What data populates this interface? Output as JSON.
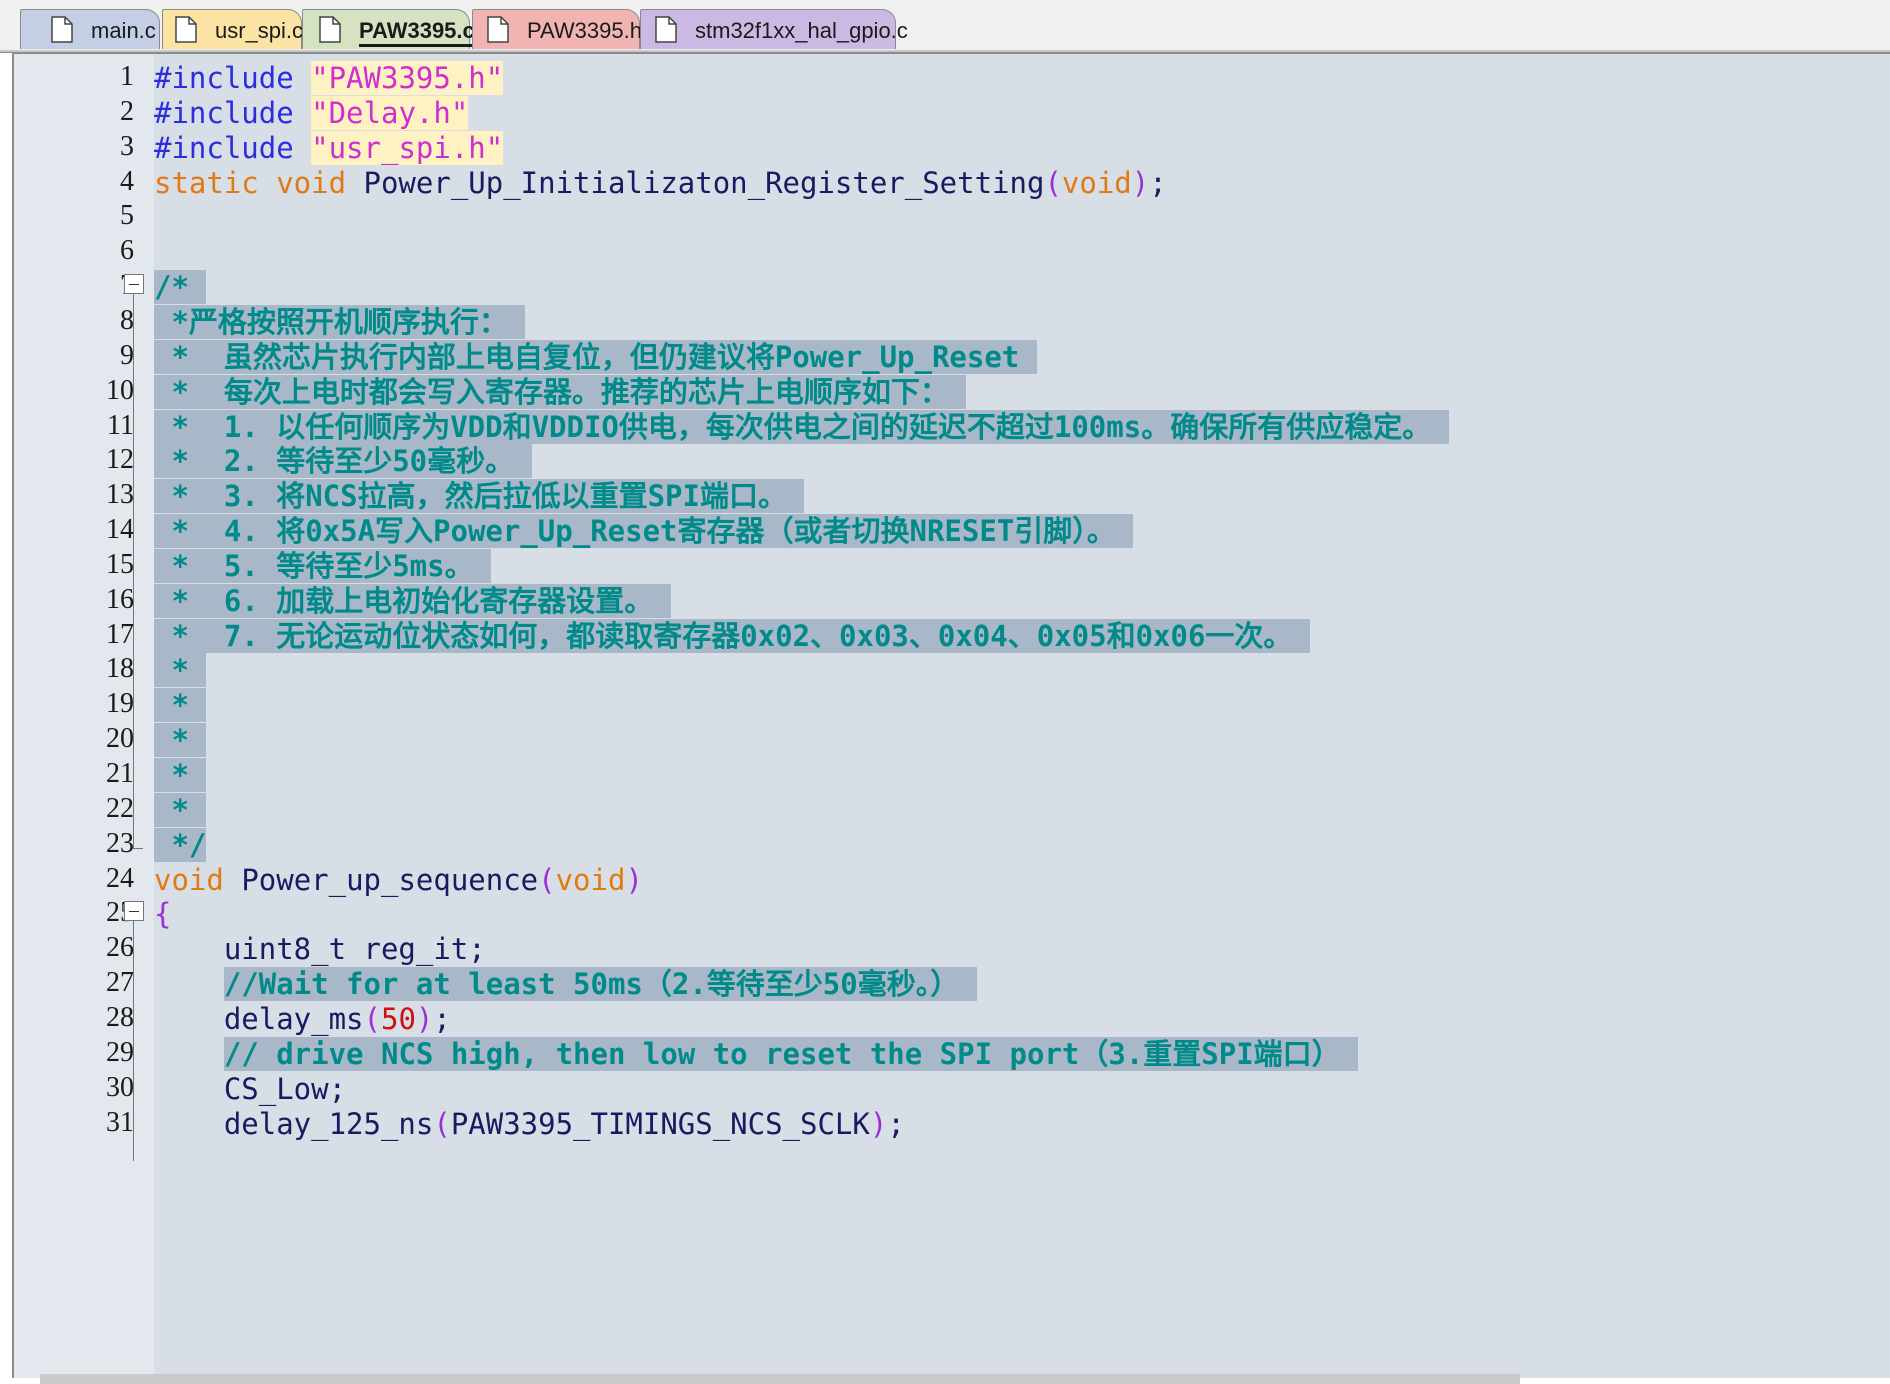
{
  "tabs": [
    {
      "label": "main.c",
      "color": "#c4cfe6",
      "active": false
    },
    {
      "label": "usr_spi.c",
      "color": "#fbe3a4",
      "active": false
    },
    {
      "label": "PAW3395.c",
      "color": "#d5e3c2",
      "active": true
    },
    {
      "label": "PAW3395.h",
      "color": "#f2b3b3",
      "active": false
    },
    {
      "label": "stm32f1xx_hal_gpio.c",
      "color": "#c9b9e3",
      "active": false
    }
  ],
  "editor": {
    "lines": [
      {
        "n": "1",
        "segs": [
          [
            "pp",
            "#include "
          ],
          [
            "str",
            "\"PAW3395.h\""
          ]
        ]
      },
      {
        "n": "2",
        "segs": [
          [
            "pp",
            "#include "
          ],
          [
            "str",
            "\"Delay.h\""
          ]
        ]
      },
      {
        "n": "3",
        "segs": [
          [
            "pp",
            "#include "
          ],
          [
            "str",
            "\"usr_spi.h\""
          ]
        ]
      },
      {
        "n": "4",
        "segs": [
          [
            "kw",
            "static void "
          ],
          [
            "fn",
            "Power_Up_Initializaton_Register_Setting"
          ],
          [
            "paren",
            "("
          ],
          [
            "kw",
            "void"
          ],
          [
            "paren",
            ")"
          ],
          [
            "plain",
            ";"
          ]
        ]
      },
      {
        "n": "5",
        "segs": []
      },
      {
        "n": "6",
        "segs": []
      },
      {
        "n": "7",
        "segs": [
          [
            "cmt",
            "/* "
          ]
        ]
      },
      {
        "n": "8",
        "segs": [
          [
            "cmt",
            " *严格按照开机顺序执行： "
          ]
        ]
      },
      {
        "n": "9",
        "segs": [
          [
            "cmt",
            " *  虽然芯片执行内部上电自复位，但仍建议将Power_Up_Reset "
          ]
        ]
      },
      {
        "n": "10",
        "segs": [
          [
            "cmt",
            " *  每次上电时都会写入寄存器。推荐的芯片上电顺序如下： "
          ]
        ]
      },
      {
        "n": "11",
        "segs": [
          [
            "cmt",
            " *  1. 以任何顺序为VDD和VDDIO供电，每次供电之间的延迟不超过100ms。确保所有供应稳定。 "
          ]
        ]
      },
      {
        "n": "12",
        "segs": [
          [
            "cmt",
            " *  2. 等待至少50毫秒。 "
          ]
        ]
      },
      {
        "n": "13",
        "segs": [
          [
            "cmt",
            " *  3. 将NCS拉高，然后拉低以重置SPI端口。 "
          ]
        ]
      },
      {
        "n": "14",
        "segs": [
          [
            "cmt",
            " *  4. 将0x5A写入Power_Up_Reset寄存器（或者切换NRESET引脚）。 "
          ]
        ]
      },
      {
        "n": "15",
        "segs": [
          [
            "cmt",
            " *  5. 等待至少5ms。 "
          ]
        ]
      },
      {
        "n": "16",
        "segs": [
          [
            "cmt",
            " *  6. 加载上电初始化寄存器设置。 "
          ]
        ]
      },
      {
        "n": "17",
        "segs": [
          [
            "cmt",
            " *  7. 无论运动位状态如何，都读取寄存器0x02、0x03、0x04、0x05和0x06一次。 "
          ]
        ]
      },
      {
        "n": "18",
        "segs": [
          [
            "cmt",
            " * "
          ]
        ]
      },
      {
        "n": "19",
        "segs": [
          [
            "cmt",
            " * "
          ]
        ]
      },
      {
        "n": "20",
        "segs": [
          [
            "cmt",
            " * "
          ]
        ]
      },
      {
        "n": "21",
        "segs": [
          [
            "cmt",
            " * "
          ]
        ]
      },
      {
        "n": "22",
        "segs": [
          [
            "cmt",
            " * "
          ]
        ]
      },
      {
        "n": "23",
        "segs": [
          [
            "cmt",
            " */"
          ]
        ]
      },
      {
        "n": "24",
        "segs": [
          [
            "kw",
            "void "
          ],
          [
            "fn",
            "Power_up_sequence"
          ],
          [
            "paren",
            "("
          ],
          [
            "kw",
            "void"
          ],
          [
            "paren",
            ")"
          ]
        ]
      },
      {
        "n": "25",
        "segs": [
          [
            "paren",
            "{"
          ]
        ]
      },
      {
        "n": "26",
        "segs": [
          [
            "plain",
            "    uint8_t reg_it;"
          ]
        ]
      },
      {
        "n": "27",
        "segs": [
          [
            "plain",
            "    "
          ],
          [
            "cmt",
            "//Wait for at least 50ms（2.等待至少50毫秒。） "
          ]
        ]
      },
      {
        "n": "28",
        "segs": [
          [
            "plain",
            "    delay_ms"
          ],
          [
            "paren",
            "("
          ],
          [
            "num",
            "50"
          ],
          [
            "paren",
            ")"
          ],
          [
            "plain",
            ";"
          ]
        ]
      },
      {
        "n": "29",
        "segs": [
          [
            "plain",
            "    "
          ],
          [
            "cmt",
            "// drive NCS high, then low to reset the SPI port（3.重置SPI端口） "
          ]
        ]
      },
      {
        "n": "30",
        "segs": [
          [
            "plain",
            "    CS_Low;"
          ]
        ]
      },
      {
        "n": "31",
        "segs": [
          [
            "plain",
            "    delay_125_ns"
          ],
          [
            "paren",
            "("
          ],
          [
            "plain",
            "PAW3395_TIMINGS_NCS_SCLK"
          ],
          [
            "paren",
            ")"
          ],
          [
            "plain",
            ";"
          ]
        ]
      }
    ]
  }
}
